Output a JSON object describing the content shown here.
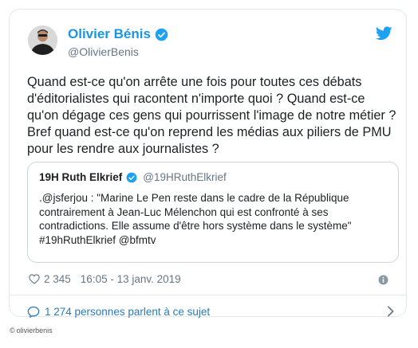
{
  "author": {
    "name": "Olivier Bénis",
    "handle": "@OlivierBenis"
  },
  "tweet": {
    "lines": [
      "Quand est-ce qu'on arrête une fois pour toutes ces débats",
      "d'éditorialistes qui racontent n'importe quoi ? Quand est-ce",
      "qu'on dégage ces gens qui pourrissent l'image de notre métier ?",
      "Bref quand est-ce qu'on reprend les médias aux piliers de PMU",
      "pour les rendre aux journalistes ?"
    ]
  },
  "quoted": {
    "name": "19H Ruth Elkrief",
    "handle": "@19HRuthElkrief",
    "lines": [
      ".@jsferjou : \"Marine Le Pen reste dans le cadre de la République",
      "contrairement à Jean-Luc Mélenchon qui est confronté à ses",
      "contradictions. Elle assume d'être hors système dans le système\"",
      "#19hRuthElkrief @bfmtv"
    ]
  },
  "meta": {
    "likes": "2 345",
    "timestamp": "16:05 - 13 janv. 2019"
  },
  "replies": {
    "label": "1 274 personnes parlent à ce sujet"
  },
  "credit": {
    "symbol": "©",
    "text": "olivierbenis"
  },
  "colors": {
    "brand": "#1da1f2",
    "link": "#1b95e0",
    "muted": "#657786",
    "border": "#e1e8ed"
  },
  "icons": [
    "verified-badge-icon",
    "twitter-bird-icon",
    "heart-icon",
    "info-icon",
    "comment-icon",
    "chevron-right-icon"
  ]
}
